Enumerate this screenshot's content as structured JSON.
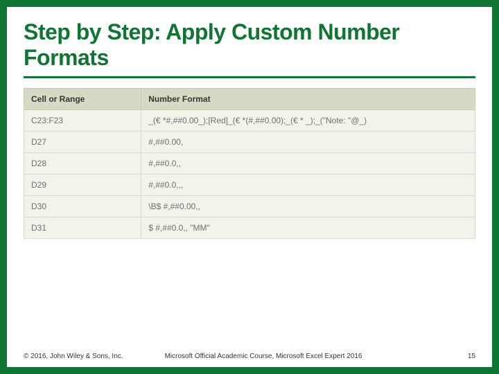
{
  "title": "Step by Step: Apply Custom Number Formats",
  "table": {
    "headers": [
      "Cell or Range",
      "Number Format"
    ],
    "rows": [
      {
        "range": "C23:F23",
        "format": "_(€ *#,##0.00_);[Red]_(€ *(#,##0.00);_(€ * _);_(\"Note: \"@_)"
      },
      {
        "range": "D27",
        "format": "#,##0.00,"
      },
      {
        "range": "D28",
        "format": "#,##0.0,,"
      },
      {
        "range": "D29",
        "format": "#,##0.0,,,"
      },
      {
        "range": "D30",
        "format": "\\B$ #,##0.00,,"
      },
      {
        "range": "D31",
        "format": "$ #,##0.0,, \"MM\""
      }
    ]
  },
  "footer": {
    "copyright": "© 2016, John Wiley & Sons, Inc.",
    "course": "Microsoft Official Academic Course, Microsoft Excel Expert 2016",
    "page": "15"
  }
}
